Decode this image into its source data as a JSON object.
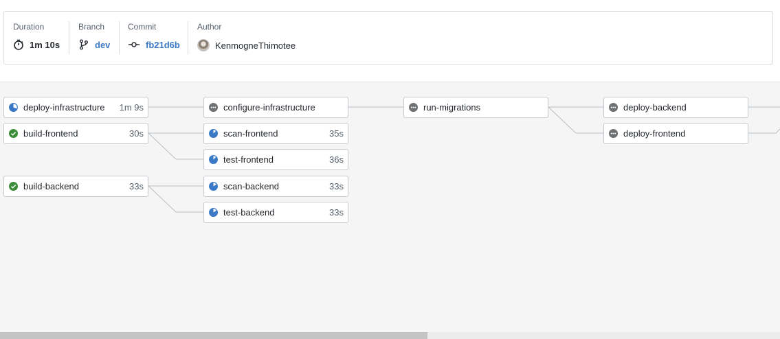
{
  "summary": {
    "duration": {
      "label": "Duration",
      "value": "1m 10s"
    },
    "branch": {
      "label": "Branch",
      "value": "dev"
    },
    "commit": {
      "label": "Commit",
      "value": "fb21d6b"
    },
    "author": {
      "label": "Author",
      "value": "KenmogneThimotee"
    }
  },
  "jobs": {
    "deploy_infrastructure": {
      "name": "deploy-infrastructure",
      "duration": "1m 9s",
      "status": "running"
    },
    "build_frontend": {
      "name": "build-frontend",
      "duration": "30s",
      "status": "success"
    },
    "build_backend": {
      "name": "build-backend",
      "duration": "33s",
      "status": "success"
    },
    "configure_infrastructure": {
      "name": "configure-infrastructure",
      "duration": "",
      "status": "pending"
    },
    "scan_frontend": {
      "name": "scan-frontend",
      "duration": "35s",
      "status": "running"
    },
    "test_frontend": {
      "name": "test-frontend",
      "duration": "36s",
      "status": "running"
    },
    "scan_backend": {
      "name": "scan-backend",
      "duration": "33s",
      "status": "running"
    },
    "test_backend": {
      "name": "test-backend",
      "duration": "33s",
      "status": "running"
    },
    "run_migrations": {
      "name": "run-migrations",
      "duration": "",
      "status": "pending"
    },
    "deploy_backend": {
      "name": "deploy-backend",
      "duration": "",
      "status": "pending"
    },
    "deploy_frontend": {
      "name": "deploy-frontend",
      "duration": "",
      "status": "pending"
    }
  },
  "colors": {
    "success": "#3b8d3a",
    "running": "#3a79c6",
    "pending": "#6e7072",
    "link": "#3a79c6"
  },
  "icons": {
    "duration": "stopwatch-icon",
    "branch": "branch-icon",
    "commit": "commit-icon",
    "success": "check-circle-icon",
    "running": "progress-pie-icon",
    "pending": "pending-dots-icon"
  }
}
